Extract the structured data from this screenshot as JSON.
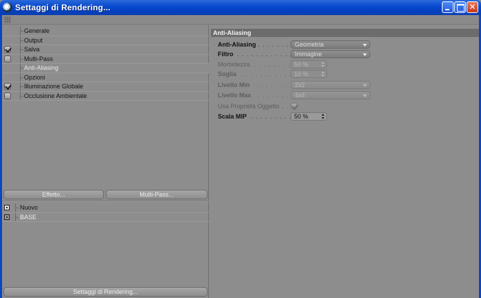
{
  "window": {
    "title": "Settaggi di Rendering...",
    "controls": [
      "minimize-icon",
      "maximize-icon",
      "close-icon"
    ]
  },
  "nav": {
    "items": [
      {
        "label": "Generale",
        "checkbox": null,
        "selected": false
      },
      {
        "label": "Output",
        "checkbox": null,
        "selected": false
      },
      {
        "label": "Salva",
        "checkbox": true,
        "selected": false
      },
      {
        "label": "Multi-Pass",
        "checkbox": false,
        "selected": false
      },
      {
        "label": "Anti-Aliasing",
        "checkbox": null,
        "selected": true
      },
      {
        "label": "Opzioni",
        "checkbox": null,
        "selected": false
      },
      {
        "label": "Illuminazione Globale",
        "checkbox": true,
        "selected": false
      },
      {
        "label": "Occlusione Ambientale",
        "checkbox": false,
        "selected": false
      }
    ]
  },
  "buttons": {
    "effetto": "Effetto...",
    "multipass": "Multi-Pass...",
    "settaggi": "Settaggi di Rendering..."
  },
  "settings_list": {
    "items": [
      {
        "label": "Nuovo",
        "active": true
      },
      {
        "label": "BASE",
        "active": false
      }
    ]
  },
  "section": {
    "title": "Anti-Aliasing"
  },
  "props": {
    "anti_aliasing": {
      "label": "Anti-Aliasing",
      "dots": ". . . . . . . .",
      "value": "Geometria"
    },
    "filtro": {
      "label": "Filtro",
      "dots": ". . . . . . . . . . . . . .",
      "value": "Immagine"
    },
    "morbidezza": {
      "label": "Morbidezza",
      "dots": ". . . . . . . . . . . .",
      "value": "50 %"
    },
    "soglia": {
      "label": "Soglia",
      "dots": ". . . . . . . . . . . . . .",
      "value": "10 %"
    },
    "livello_min": {
      "label": "Livello Min",
      "dots": ". . . . . . . . . .",
      "value": "2x2"
    },
    "livello_max": {
      "label": "Livello Max",
      "dots": ". . . . . . . . . .",
      "value": "4x4"
    },
    "usa_proprieta": {
      "label": "Usa Proprietà Oggetto",
      "dots": ". . .",
      "checked": true
    },
    "scala_mip": {
      "label": "Scala MIP",
      "dots": ". . . . . . . . . . . .",
      "value": "50 %"
    }
  }
}
